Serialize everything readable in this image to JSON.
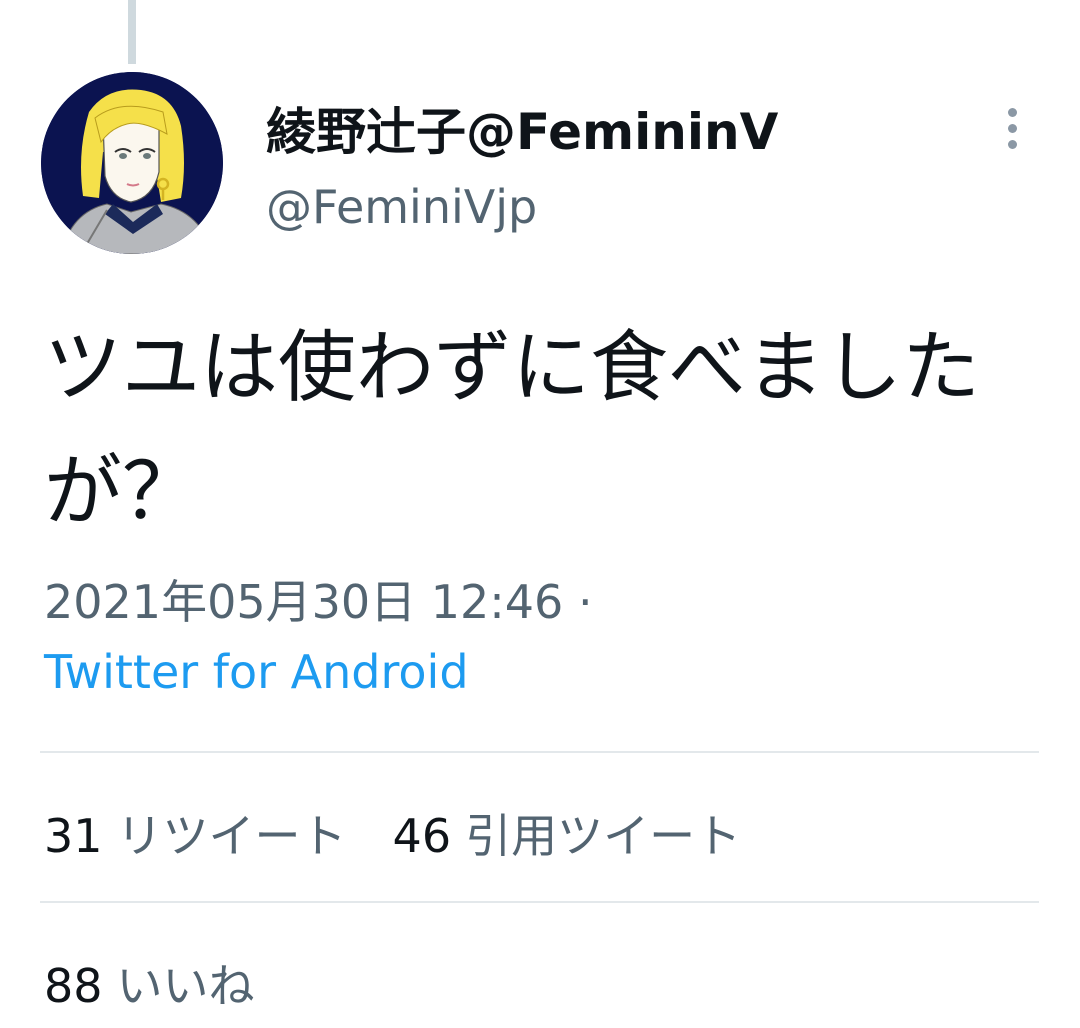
{
  "tweet": {
    "author": {
      "display_name": "綾野辻子@FemininV",
      "handle": "@FeminiVjp"
    },
    "text": "ツユは使わずに食べましたが？",
    "timestamp": "2021年05月30日 12:46 ·",
    "source": "Twitter for Android",
    "stats": {
      "retweets": {
        "count": "31",
        "label": "リツイート"
      },
      "quote_tweets": {
        "count": "46",
        "label": "引用ツイート"
      },
      "likes": {
        "count": "88",
        "label": "いいね"
      }
    }
  },
  "icons": {
    "more": "more-vertical-icon",
    "avatar": "avatar"
  },
  "colors": {
    "text_primary": "#0f1419",
    "text_secondary": "#536471",
    "link": "#1d9bf0",
    "divider": "#e3e8eb"
  }
}
